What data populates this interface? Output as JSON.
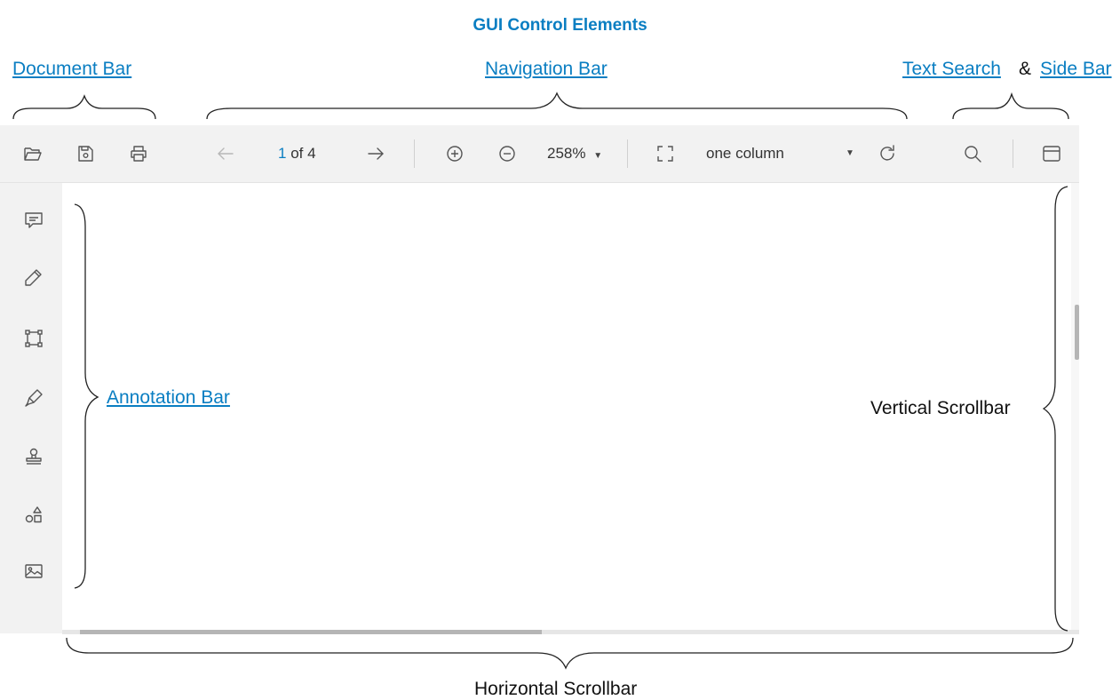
{
  "title": "GUI Control Elements",
  "labels": {
    "document_bar": "Document Bar",
    "navigation_bar": "Navigation Bar",
    "text_search": "Text Search",
    "ampersand": "&",
    "side_bar": "Side Bar",
    "annotation_bar": "Annotation Bar",
    "vertical_scrollbar": "Vertical Scrollbar",
    "horizontal_scrollbar": "Horizontal Scrollbar"
  },
  "toolbar": {
    "current_page": "1",
    "page_of": "of 4",
    "zoom": "258%",
    "layout_mode": "one column",
    "icons": [
      "folder-open-icon",
      "save-icon",
      "print-icon",
      "arrow-left-icon",
      "arrow-right-icon",
      "zoom-in-icon",
      "zoom-out-icon",
      "dropdown-caret-icon",
      "fullscreen-icon",
      "rotate-icon",
      "search-icon",
      "sidebar-panel-icon"
    ]
  },
  "annotation_bar": {
    "icons": [
      "comment-icon",
      "pencil-icon",
      "rectangle-selection-icon",
      "highlighter-icon",
      "stamp-icon",
      "shapes-icon",
      "image-icon"
    ]
  },
  "colors": {
    "accent": "#0a7ec2",
    "toolbar_bg": "#f2f2f2",
    "icon": "#555555",
    "disabled_icon": "#b8b8b8"
  }
}
